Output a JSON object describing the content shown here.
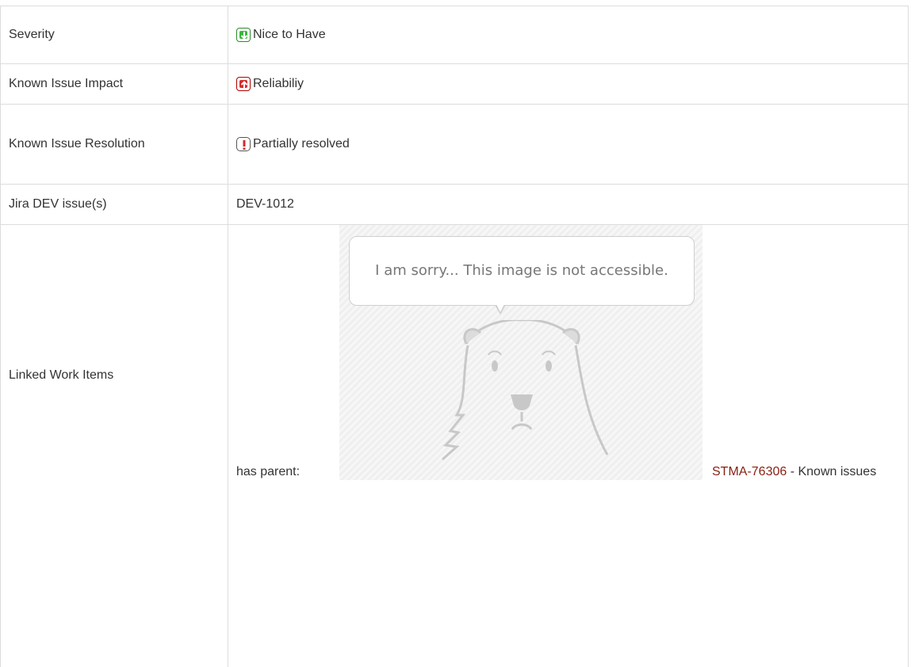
{
  "rows": [
    {
      "label": "Severity",
      "value": "Nice to Have",
      "icon": "priority-minor-icon"
    },
    {
      "label": "Known Issue Impact",
      "value": "Reliabiliy",
      "icon": "priority-major-icon"
    },
    {
      "label": "Known Issue Resolution",
      "value": "Partially resolved",
      "icon": "exclamation-icon"
    },
    {
      "label": "Jira DEV issue(s)",
      "value": "DEV-1012"
    },
    {
      "label": "Linked Work Items"
    }
  ],
  "linked": {
    "relation": "has parent:",
    "image_message": "I am sorry... This image is not accessible.",
    "issue_key": "STMA-76306",
    "issue_summary": " - Known issues"
  },
  "colors": {
    "link": "#8a1f11",
    "border": "#dcdcdc",
    "text": "#333333"
  }
}
